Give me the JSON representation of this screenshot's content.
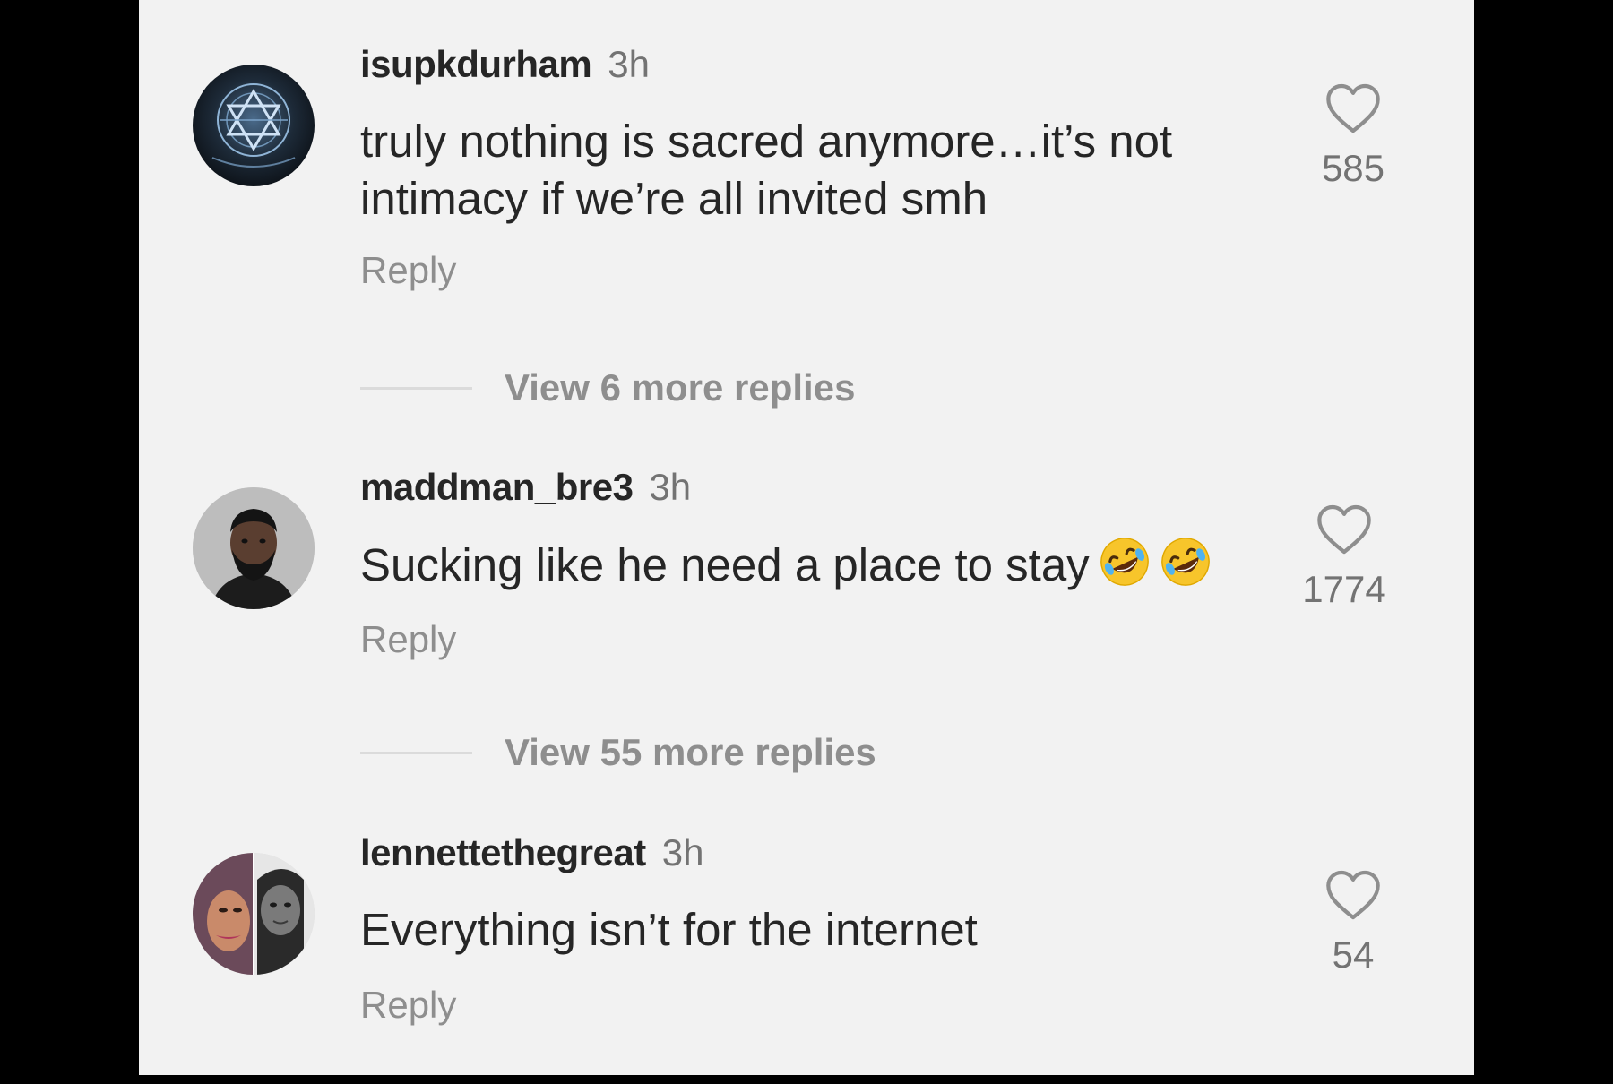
{
  "comments": [
    {
      "username": "isupkdurham",
      "time": "3h",
      "text": "truly nothing is sacred anymore…it’s not intimacy if we’re all invited smh",
      "reply_label": "Reply",
      "likes": "585",
      "avatar_icon": "hexagram-logo-avatar"
    },
    {
      "username": "maddman_bre3",
      "time": "3h",
      "text": "Sucking like he need a place to stay",
      "emoji": [
        "rolling-on-floor-laughing",
        "rolling-on-floor-laughing"
      ],
      "reply_label": "Reply",
      "likes": "1774",
      "avatar_icon": "man-portrait-avatar"
    },
    {
      "username": "lennettethegreat",
      "time": "3h",
      "text": "Everything isn’t for the internet",
      "reply_label": "Reply",
      "likes": "54",
      "avatar_icon": "two-faces-avatar"
    }
  ],
  "view_more": [
    {
      "label": "View 6 more replies"
    },
    {
      "label": "View 55 more replies"
    }
  ],
  "colors": {
    "background": "#f2f2f2",
    "text": "#262626",
    "muted": "#8e8e8e",
    "frame": "#000000"
  }
}
